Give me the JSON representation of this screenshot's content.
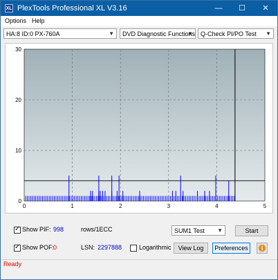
{
  "window": {
    "title": "PlexTools Professional XL V3.16",
    "icon_label": "XL",
    "minimize": "—",
    "maximize": "☐",
    "close": "✕"
  },
  "menu": {
    "options": "Options",
    "help": "Help"
  },
  "toolbar": {
    "drive": "HA:8 ID:0  PX-760A",
    "function": "DVD Diagnostic Functions",
    "test": "Q-Check PI/PO Test"
  },
  "chart_data": {
    "type": "bar",
    "xlim": [
      0,
      5
    ],
    "ylim": [
      0,
      30
    ],
    "x_ticks": [
      "0",
      "1",
      "2",
      "3",
      "4",
      "5"
    ],
    "y_ticks": [
      "0",
      "10",
      "20",
      "30"
    ],
    "grid": true,
    "threshold_line": 4,
    "end_marker_x": 4.38,
    "baseline_level": 1,
    "spikes": [
      {
        "x": 1.38,
        "y": 2
      },
      {
        "x": 1.42,
        "y": 2
      },
      {
        "x": 1.55,
        "y": 2
      },
      {
        "x": 1.58,
        "y": 2
      },
      {
        "x": 1.63,
        "y": 2
      },
      {
        "x": 1.68,
        "y": 2
      },
      {
        "x": 1.82,
        "y": 2
      },
      {
        "x": 1.93,
        "y": 2
      },
      {
        "x": 2.05,
        "y": 2
      },
      {
        "x": 2.4,
        "y": 2
      },
      {
        "x": 3.08,
        "y": 2
      },
      {
        "x": 3.15,
        "y": 2
      },
      {
        "x": 3.3,
        "y": 2
      },
      {
        "x": 3.6,
        "y": 2
      },
      {
        "x": 3.75,
        "y": 2
      },
      {
        "x": 3.85,
        "y": 2
      },
      {
        "x": 0.93,
        "y": 5
      },
      {
        "x": 1.55,
        "y": 5
      },
      {
        "x": 1.82,
        "y": 5
      },
      {
        "x": 1.97,
        "y": 5
      },
      {
        "x": 3.25,
        "y": 5
      },
      {
        "x": 3.98,
        "y": 5
      },
      {
        "x": 4.25,
        "y": 4
      }
    ]
  },
  "controls": {
    "show_pif_label": "Show PIF:",
    "pif_value": "998",
    "pif_unit": "rows/1ECC",
    "show_pof_label": "Show POF:",
    "pof_value": "0",
    "lsn_label": "LSN:",
    "lsn_value": "2297888",
    "logarithmic_label": "Logarithmic",
    "sum_select": "SUM1 Test",
    "start": "Start",
    "view_log": "View Log",
    "preferences": "Preferences",
    "info_glyph": "i"
  },
  "status": {
    "text": "Ready"
  },
  "colors": {
    "title_bar": "#0b5fa5",
    "bar_color": "#0000ff",
    "status_text": "#e00000"
  }
}
